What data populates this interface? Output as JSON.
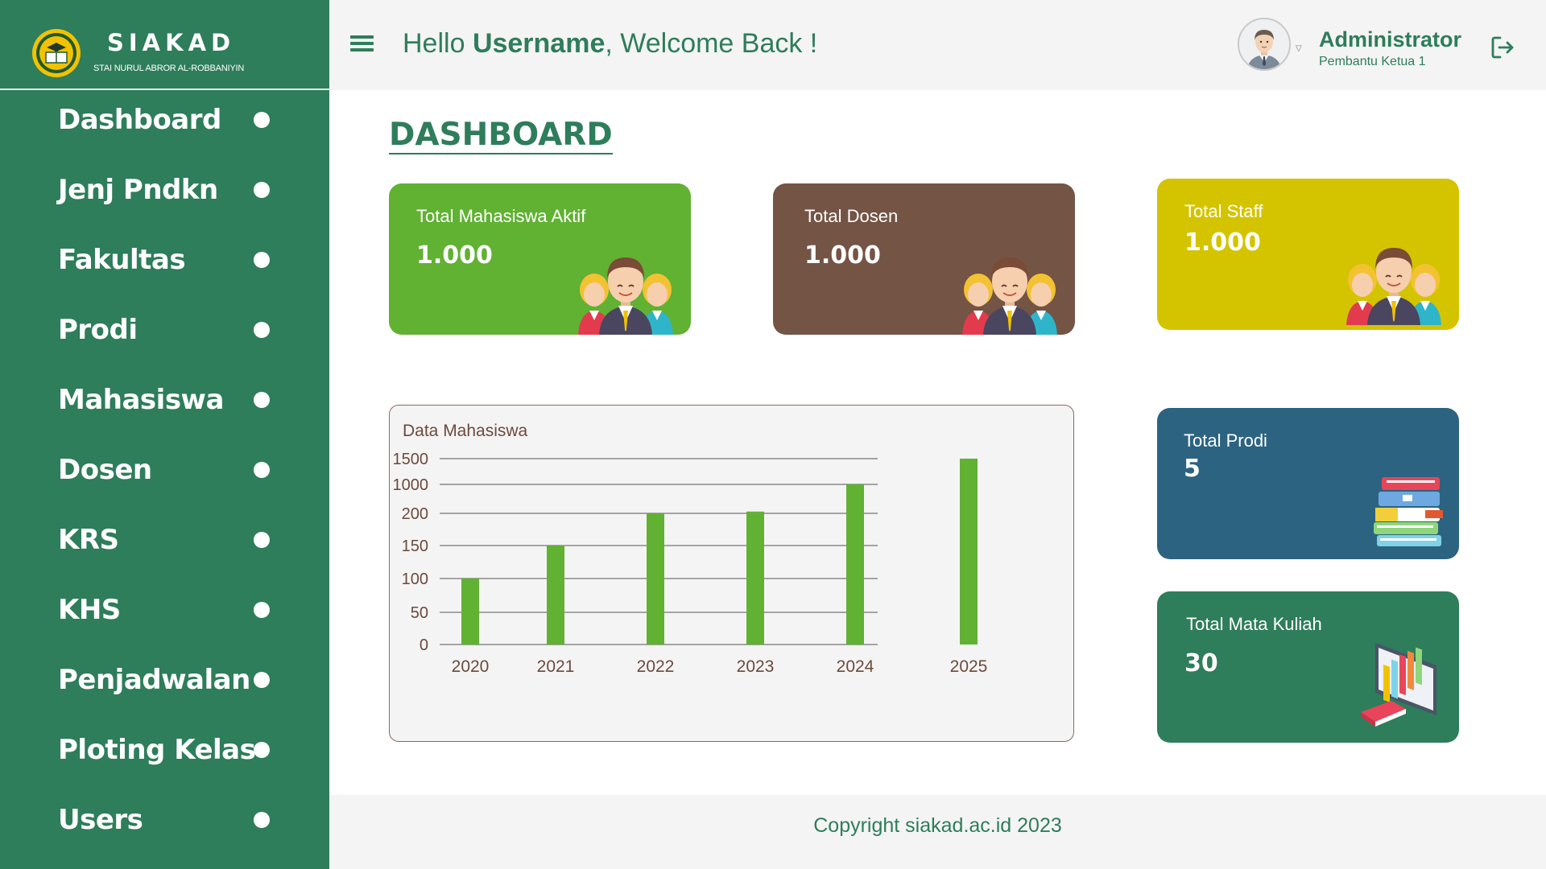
{
  "brand": {
    "title": "SIAKAD",
    "subtitle": "STAI NURUL ABROR AL-ROBBANIYIN"
  },
  "sidebar": {
    "items": [
      {
        "label": "Dashboard"
      },
      {
        "label": "Jenj Pndkn"
      },
      {
        "label": "Fakultas"
      },
      {
        "label": "Prodi"
      },
      {
        "label": "Mahasiswa"
      },
      {
        "label": "Dosen"
      },
      {
        "label": "KRS"
      },
      {
        "label": "KHS"
      },
      {
        "label": "Penjadwalan"
      },
      {
        "label": "Ploting Kelas"
      },
      {
        "label": "Users"
      }
    ]
  },
  "header": {
    "greeting_prefix": "Hello ",
    "username": "Username",
    "greeting_suffix": ", Welcome Back !",
    "user_name": "Administrator",
    "user_role": "Pembantu Ketua 1",
    "menu_icon": "hamburger-menu-icon",
    "logout_icon": "logout-icon"
  },
  "page": {
    "title": "DASHBOARD"
  },
  "cards": {
    "mahasiswa": {
      "label": "Total Mahasiswa Aktif",
      "value": "1.000",
      "color": "#61b133",
      "icon": "people-icon"
    },
    "dosen": {
      "label": "Total Dosen",
      "value": "1.000",
      "color": "#745445",
      "icon": "people-icon"
    },
    "staff": {
      "label": "Total Staff",
      "value": "1.000",
      "color": "#d4c400",
      "icon": "people-icon"
    },
    "prodi": {
      "label": "Total Prodi",
      "value": "5",
      "color": "#2c6381",
      "icon": "books-icon"
    },
    "matkul": {
      "label": "Total Mata Kuliah",
      "value": "30",
      "color": "#2e7d5b",
      "icon": "bookshelf-icon"
    }
  },
  "chart_data": {
    "type": "bar",
    "title": "Data Mahasiswa",
    "categories": [
      "2020",
      "2021",
      "2022",
      "2023",
      "2024",
      "2025"
    ],
    "values": [
      100,
      150,
      200,
      250,
      1000,
      1500
    ],
    "yticks": [
      "0",
      "50",
      "100",
      "150",
      "200",
      "1000",
      "1500"
    ],
    "grid": true,
    "bar_color": "#61b133"
  },
  "footer": {
    "text": "Copyright siakad.ac.id 2023"
  }
}
